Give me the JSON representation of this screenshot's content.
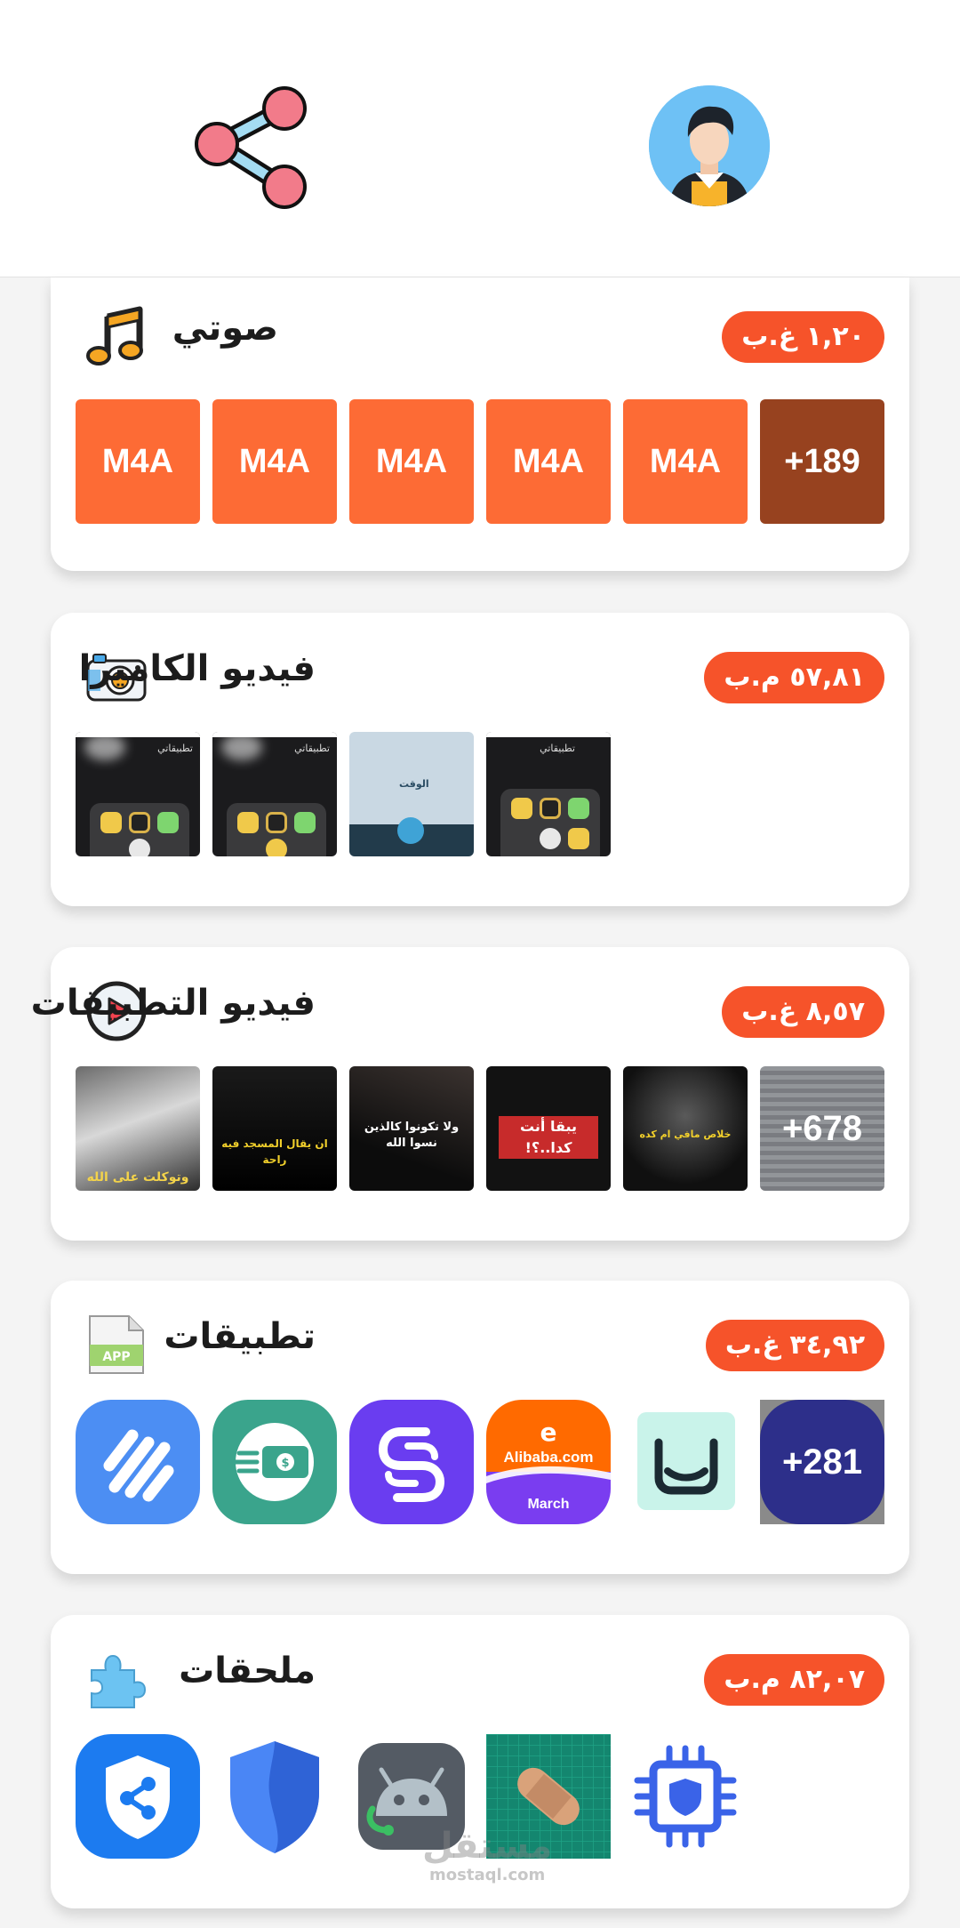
{
  "header": {
    "share_icon": "share-icon",
    "avatar_icon": "user-avatar"
  },
  "colors": {
    "accent": "#f6532a",
    "audio_tile": "#fd6b35",
    "audio_more_tile": "#97421f"
  },
  "categories": [
    {
      "id": "audio",
      "title": "صوتي",
      "size": "١,٢٠ غ.ب",
      "icon": "music-note-icon",
      "tiles": [
        "M4A",
        "M4A",
        "M4A",
        "M4A",
        "M4A"
      ],
      "more": "+189"
    },
    {
      "id": "camera_video",
      "title": "فيديو الكاميرا",
      "size": "٥٧,٨١ م.ب",
      "icon": "camera-icon",
      "tiles": [
        "تطبيقاتي",
        "تطبيقاتي",
        "الوقت",
        "تطبيقاتي"
      ]
    },
    {
      "id": "app_video",
      "title": "فيديو التطبيقات",
      "size": "٨,٥٧ غ.ب",
      "icon": "play-circle-icon",
      "tiles": [
        "وتوكلت على الله",
        "ان يقال المسجد فيه راحة",
        "ولا تكونوا كالذين نسوا الله",
        "يبقا أنت كدا..؟!",
        "خلاص مافي ام كده",
        ""
      ],
      "more": "+678"
    },
    {
      "id": "apps",
      "title": "تطبيقات",
      "size": "٣٤,٩٢ غ.ب",
      "icon": "apk-file-icon",
      "tiles": [
        "",
        "",
        "",
        "Alibaba.com",
        "",
        ""
      ],
      "tile_sub": "March",
      "apk_label": "APP",
      "more": "+281"
    },
    {
      "id": "addons",
      "title": "ملحقات",
      "size": "٨٢,٠٧ م.ب",
      "icon": "puzzle-icon",
      "tiles": [
        "",
        "",
        "",
        "",
        ""
      ]
    }
  ],
  "watermark": {
    "arabic": "مستقل",
    "latin": "mostaql.com"
  }
}
